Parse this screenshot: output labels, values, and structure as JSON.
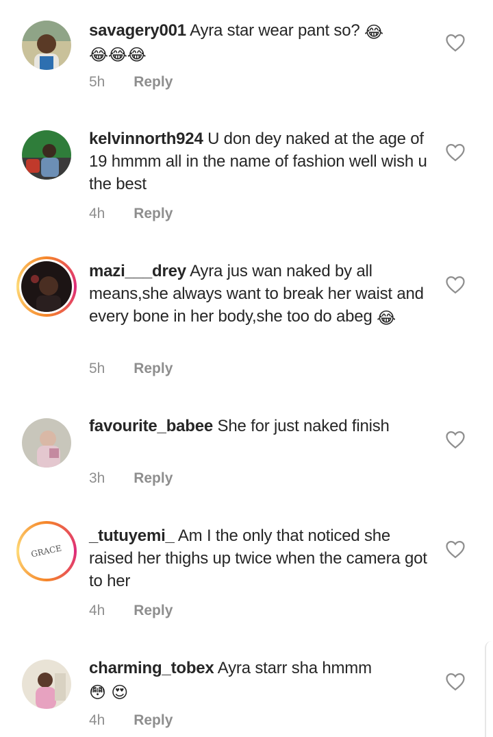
{
  "comments": [
    {
      "username": "savagery001",
      "text": "Ayra star wear pant so?",
      "emojis_inline": "😂",
      "emojis_next_line": "😂😂😂",
      "time": "5h",
      "reply": "Reply",
      "avatar_icon": "person-photo"
    },
    {
      "username": "kelvinnorth924",
      "text": "U don dey naked at the age of 19 hmmm all in the name of fashion  well wish u the best",
      "time": "4h",
      "reply": "Reply",
      "avatar_icon": "person-photo"
    },
    {
      "username": "mazi___drey",
      "text": "Ayra jus wan naked by all means,she always want to break her waist and every bone in her body,she too do abeg",
      "emojis_inline": "😂",
      "time": "5h",
      "reply": "Reply",
      "avatar_icon": "person-photo"
    },
    {
      "username": "favourite_babee",
      "text": "She for just naked finish",
      "time": "3h",
      "reply": "Reply",
      "avatar_icon": "person-photo"
    },
    {
      "username": "_tutuyemi_",
      "text": "Am I the only that noticed she raised her thighs up twice when the camera got to her",
      "time": "4h",
      "reply": "Reply",
      "avatar_text": "GRACE"
    },
    {
      "username": "charming_tobex",
      "text": "Ayra starr sha hmmm",
      "emojis_next_line": "😳 😍",
      "time": "4h",
      "reply": "Reply",
      "avatar_icon": "person-photo"
    }
  ],
  "colors": {
    "username": "#262626",
    "text": "#262626",
    "meta": "#8e8e8e",
    "heart_outline": "#8e8e8e",
    "story_ring_start": "#f58529",
    "story_ring_end": "#dd2a7b"
  },
  "icons": {
    "like": "heart-outline-icon"
  }
}
